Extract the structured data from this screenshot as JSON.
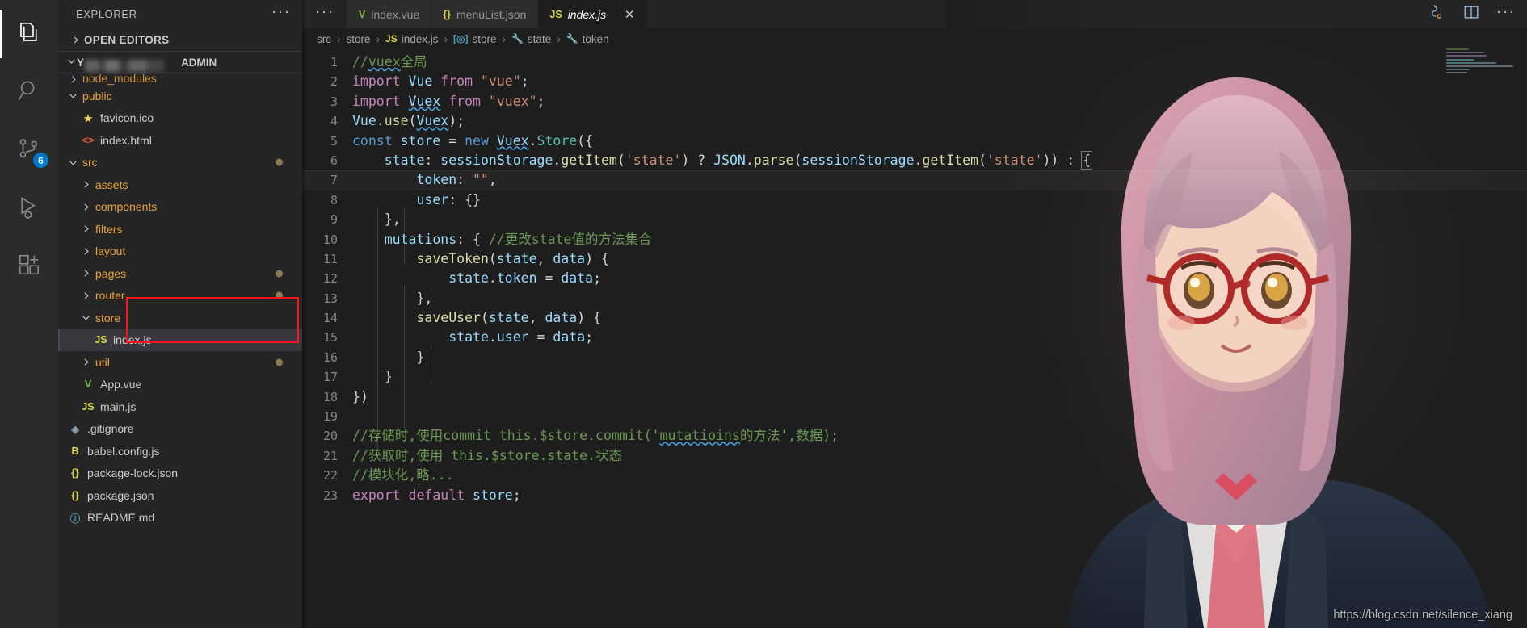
{
  "activitybar": {
    "items": [
      {
        "name": "explorer",
        "icon": "files-icon",
        "active": true,
        "badge": null
      },
      {
        "name": "search",
        "icon": "search-icon",
        "active": false,
        "badge": null
      },
      {
        "name": "source-control",
        "icon": "source-control-icon",
        "active": false,
        "badge": "6"
      },
      {
        "name": "run-and-debug",
        "icon": "run-debug-icon",
        "active": false,
        "badge": null
      },
      {
        "name": "extensions",
        "icon": "extensions-icon",
        "active": false,
        "badge": null
      }
    ]
  },
  "sidebar": {
    "title": "EXPLORER",
    "more_actions": "···",
    "open_editors_label": "OPEN EDITORS",
    "project_name_suffix": "ADMIN",
    "project_name_prefix": "Y",
    "tree": [
      {
        "label": "node_modules",
        "type": "folder",
        "depth": 1,
        "expanded": false,
        "icon": "folder-icon",
        "cut": true,
        "dirty": false,
        "selected": false
      },
      {
        "label": "public",
        "type": "folder",
        "depth": 1,
        "expanded": true,
        "icon": "folder-icon",
        "cut": false,
        "dirty": false,
        "selected": false
      },
      {
        "label": "favicon.ico",
        "type": "file",
        "depth": 2,
        "expanded": null,
        "icon": "star-icon",
        "iconglyph": "★",
        "color": "c-star",
        "cut": false,
        "dirty": false,
        "selected": false
      },
      {
        "label": "index.html",
        "type": "file",
        "depth": 2,
        "expanded": null,
        "icon": "html-icon",
        "iconglyph": "<>",
        "color": "c-html",
        "cut": false,
        "dirty": false,
        "selected": false
      },
      {
        "label": "src",
        "type": "folder",
        "depth": 1,
        "expanded": true,
        "icon": "folder-icon",
        "cut": false,
        "dirty": true,
        "selected": false
      },
      {
        "label": "assets",
        "type": "folder",
        "depth": 2,
        "expanded": false,
        "icon": "folder-icon",
        "cut": false,
        "dirty": false,
        "selected": false
      },
      {
        "label": "components",
        "type": "folder",
        "depth": 2,
        "expanded": false,
        "icon": "folder-icon",
        "cut": false,
        "dirty": false,
        "selected": false
      },
      {
        "label": "filters",
        "type": "folder",
        "depth": 2,
        "expanded": false,
        "icon": "folder-icon",
        "cut": false,
        "dirty": false,
        "selected": false
      },
      {
        "label": "layout",
        "type": "folder",
        "depth": 2,
        "expanded": false,
        "icon": "folder-icon",
        "cut": false,
        "dirty": false,
        "selected": false
      },
      {
        "label": "pages",
        "type": "folder",
        "depth": 2,
        "expanded": false,
        "icon": "folder-icon",
        "cut": false,
        "dirty": true,
        "selected": false
      },
      {
        "label": "router",
        "type": "folder",
        "depth": 2,
        "expanded": false,
        "icon": "folder-icon",
        "cut": false,
        "dirty": true,
        "selected": false
      },
      {
        "label": "store",
        "type": "folder",
        "depth": 2,
        "expanded": true,
        "icon": "folder-icon",
        "cut": false,
        "dirty": false,
        "selected": false
      },
      {
        "label": "index.js",
        "type": "file",
        "depth": 3,
        "expanded": null,
        "icon": "js-icon",
        "iconglyph": "JS",
        "color": "c-js",
        "cut": false,
        "dirty": false,
        "selected": true
      },
      {
        "label": "util",
        "type": "folder",
        "depth": 2,
        "expanded": false,
        "icon": "folder-icon",
        "cut": false,
        "dirty": true,
        "selected": false
      },
      {
        "label": "App.vue",
        "type": "file",
        "depth": 2,
        "expanded": null,
        "icon": "vue-icon",
        "iconglyph": "V",
        "color": "c-vue",
        "cut": false,
        "dirty": false,
        "selected": false
      },
      {
        "label": "main.js",
        "type": "file",
        "depth": 2,
        "expanded": null,
        "icon": "js-icon",
        "iconglyph": "JS",
        "color": "c-js",
        "cut": false,
        "dirty": false,
        "selected": false
      },
      {
        "label": ".gitignore",
        "type": "file",
        "depth": 1,
        "expanded": null,
        "icon": "git-icon",
        "iconglyph": "◈",
        "color": "c-git",
        "cut": false,
        "dirty": false,
        "selected": false
      },
      {
        "label": "babel.config.js",
        "type": "file",
        "depth": 1,
        "expanded": null,
        "icon": "babel-icon",
        "iconglyph": "B",
        "color": "c-babel",
        "cut": false,
        "dirty": false,
        "selected": false
      },
      {
        "label": "package-lock.json",
        "type": "file",
        "depth": 1,
        "expanded": null,
        "icon": "json-icon",
        "iconglyph": "{}",
        "color": "c-json",
        "cut": false,
        "dirty": false,
        "selected": false
      },
      {
        "label": "package.json",
        "type": "file",
        "depth": 1,
        "expanded": null,
        "icon": "json-icon",
        "iconglyph": "{}",
        "color": "c-json",
        "cut": false,
        "dirty": false,
        "selected": false
      },
      {
        "label": "README.md",
        "type": "file",
        "depth": 1,
        "expanded": null,
        "icon": "info-icon",
        "iconglyph": "ⓘ",
        "color": "c-md",
        "cut": false,
        "dirty": false,
        "selected": false
      }
    ]
  },
  "editor": {
    "overflow_tabs": "···",
    "tabs": [
      {
        "label": "index.vue",
        "icon": "vue-icon",
        "iconglyph": "V",
        "color": "c-vue",
        "active": false,
        "preview": false
      },
      {
        "label": "menuList.json",
        "icon": "json-icon",
        "iconglyph": "{}",
        "color": "c-json",
        "active": false,
        "preview": false
      },
      {
        "label": "index.js",
        "icon": "js-icon",
        "iconglyph": "JS",
        "color": "c-js",
        "active": true,
        "preview": true
      }
    ],
    "close_label": "✕",
    "actions": [
      {
        "name": "split-editor-right-icon",
        "label": "⫢"
      },
      {
        "name": "split-editor-icon",
        "label": "◫"
      },
      {
        "name": "more-actions-icon",
        "label": "···"
      }
    ],
    "breadcrumb": [
      {
        "label": "src",
        "icon": null
      },
      {
        "label": "store",
        "icon": null
      },
      {
        "label": "index.js",
        "icon": "js-icon",
        "iconglyph": "JS",
        "color": "c-js"
      },
      {
        "label": "store",
        "icon": "module-icon",
        "iconglyph": "[◎]",
        "color": "c-md"
      },
      {
        "label": "state",
        "icon": "property-icon",
        "iconglyph": "🔧",
        "color": "c-folder"
      },
      {
        "label": "token",
        "icon": "property-icon",
        "iconglyph": "🔧",
        "color": "c-folder"
      }
    ],
    "breadcrumb_separator": "›",
    "language": "javascript",
    "current_line": 7,
    "code": [
      {
        "num": "1",
        "text": "//vuex全局"
      },
      {
        "num": "2",
        "text": "import Vue from \"vue\";"
      },
      {
        "num": "3",
        "text": "import Vuex from \"vuex\";"
      },
      {
        "num": "4",
        "text": "Vue.use(Vuex);"
      },
      {
        "num": "5",
        "text": "const store = new Vuex.Store({"
      },
      {
        "num": "6",
        "text": "    state: sessionStorage.getItem('state') ? JSON.parse(sessionStorage.getItem('state')) : {"
      },
      {
        "num": "7",
        "text": "        token: \"\","
      },
      {
        "num": "8",
        "text": "        user: {}"
      },
      {
        "num": "9",
        "text": "    },"
      },
      {
        "num": "10",
        "text": "    mutations: { //更改state值的方法集合"
      },
      {
        "num": "11",
        "text": "        saveToken(state, data) {"
      },
      {
        "num": "12",
        "text": "            state.token = data;"
      },
      {
        "num": "13",
        "text": "        },"
      },
      {
        "num": "14",
        "text": "        saveUser(state, data) {"
      },
      {
        "num": "15",
        "text": "            state.user = data;"
      },
      {
        "num": "16",
        "text": "        }"
      },
      {
        "num": "17",
        "text": "    }"
      },
      {
        "num": "18",
        "text": "})"
      },
      {
        "num": "19",
        "text": ""
      },
      {
        "num": "20",
        "text": "//存储时,使用commit this.$store.commit('mutatioins的方法',数据);"
      },
      {
        "num": "21",
        "text": "//获取时,使用 this.$store.state.状态"
      },
      {
        "num": "22",
        "text": "//模块化,略..."
      },
      {
        "num": "23",
        "text": "export default store;"
      }
    ]
  },
  "watermark": "https://blog.csdn.net/silence_xiang",
  "colors": {
    "accent": "#007acc",
    "highlight_box": "#fa1414",
    "editor_bg": "#1e1e1e",
    "sidebar_bg": "#252526",
    "activitybar_bg": "#2b2b2b",
    "comment": "#6A9955",
    "keyword": "#C586C0",
    "string": "#CE9178",
    "function": "#DCDCAA",
    "variable": "#9CDCFE"
  }
}
